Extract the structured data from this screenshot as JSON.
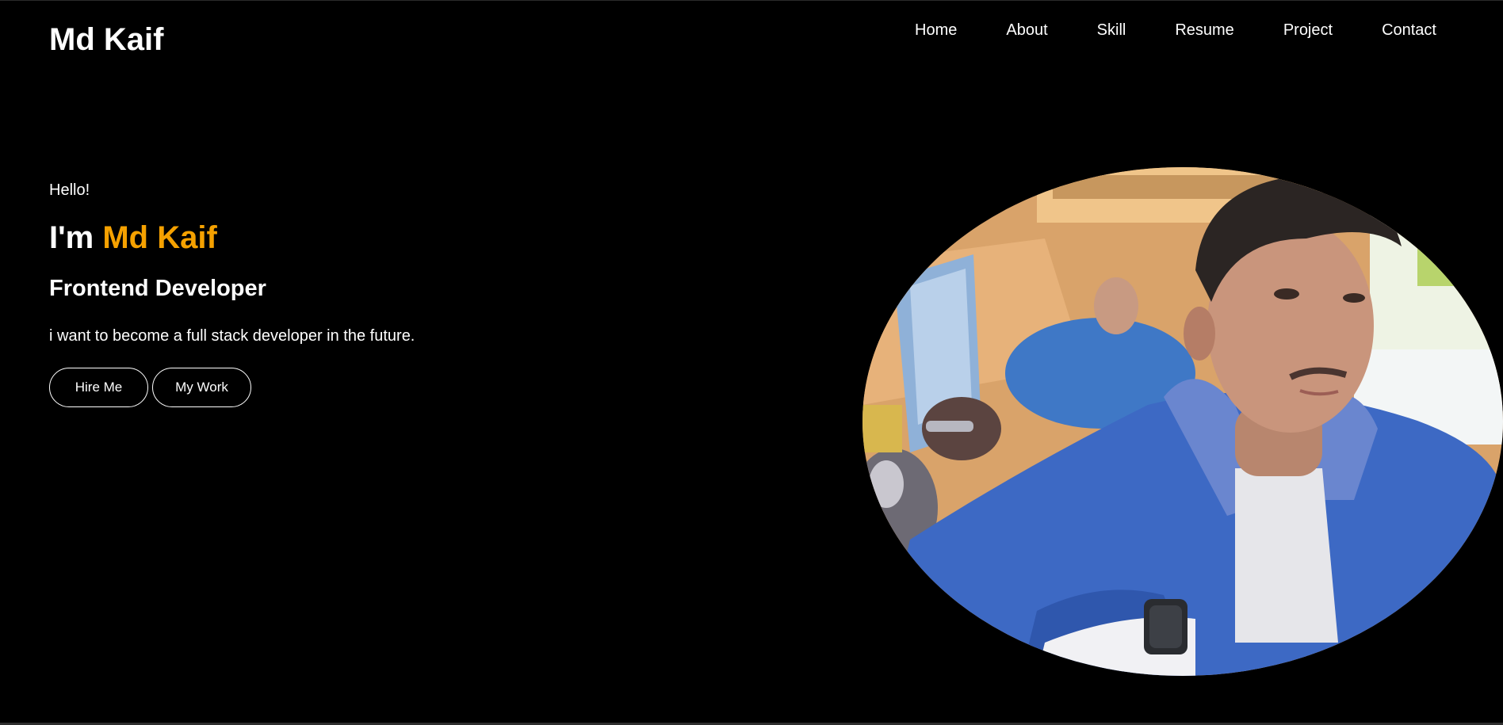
{
  "header": {
    "logo": "Md Kaif",
    "nav": [
      {
        "label": "Home"
      },
      {
        "label": "About"
      },
      {
        "label": "Skill"
      },
      {
        "label": "Resume"
      },
      {
        "label": "Project"
      },
      {
        "label": "Contact"
      }
    ]
  },
  "hero": {
    "greeting": "Hello!",
    "headline_prefix": "I'm",
    "headline_name": "Md Kaif",
    "role": "Frontend Developer",
    "tagline": "i want to become a full stack developer in the future.",
    "buttons": {
      "hire": "Hire Me",
      "work": "My Work"
    }
  },
  "theme": {
    "background": "#000000",
    "text": "#ffffff",
    "accent": "#f5a100"
  }
}
